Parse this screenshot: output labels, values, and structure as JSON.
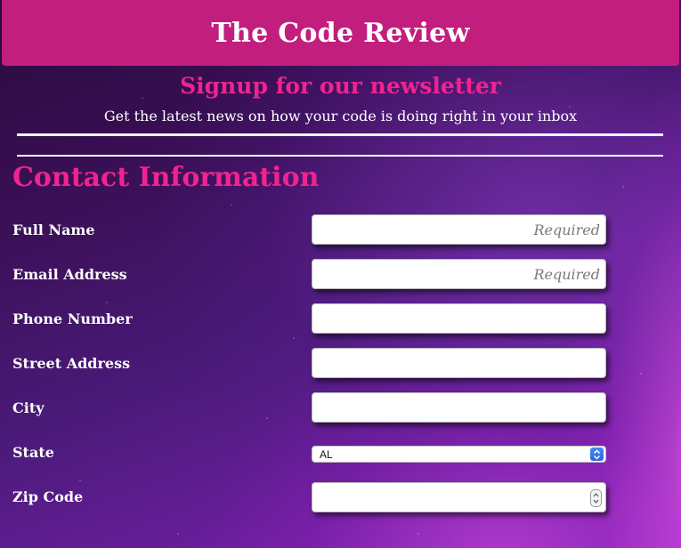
{
  "header": {
    "title": "The Code Review"
  },
  "intro": {
    "title": "Signup for our newsletter",
    "subtitle": "Get the latest news on how your code is doing right in your inbox"
  },
  "contact": {
    "section_title": "Contact Information",
    "fields": [
      {
        "label": "Full Name",
        "placeholder": "Required",
        "value": ""
      },
      {
        "label": "Email Address",
        "placeholder": "Required",
        "value": ""
      },
      {
        "label": "Phone Number",
        "placeholder": "",
        "value": ""
      },
      {
        "label": "Street Address",
        "placeholder": "",
        "value": ""
      },
      {
        "label": "City",
        "placeholder": "",
        "value": ""
      }
    ],
    "state": {
      "label": "State",
      "selected": "AL"
    },
    "zip": {
      "label": "Zip Code",
      "value": ""
    }
  },
  "colors": {
    "header_bg": "#c21e7e",
    "accent_pink": "#f0238f",
    "background": "#3b1058"
  },
  "icons": {
    "state_select": "chevron-up-down-icon",
    "zip_spinner": "spinner-arrows-icon"
  }
}
